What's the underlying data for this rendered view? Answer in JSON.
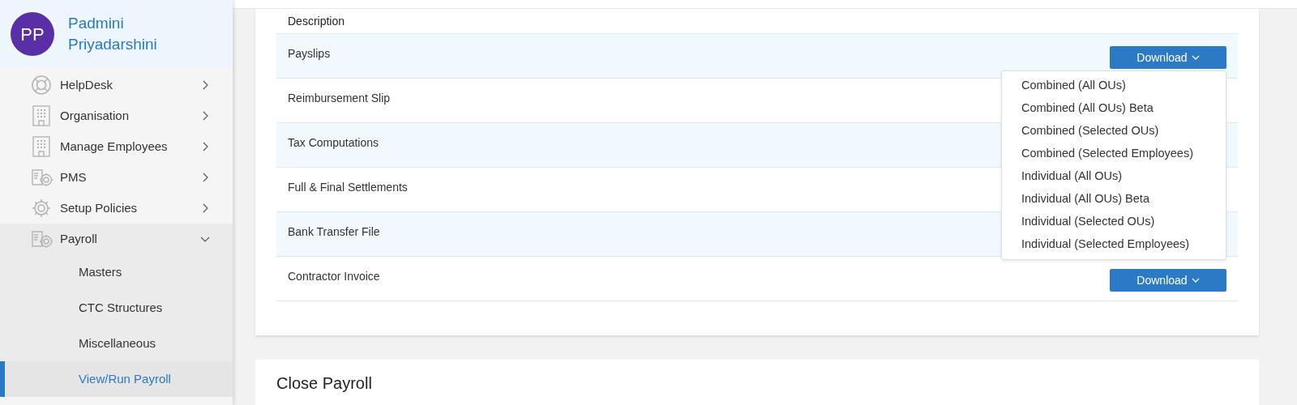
{
  "user": {
    "initials": "PP",
    "name": "Padmini Priyadarshini"
  },
  "sidebar": {
    "items": [
      {
        "label": "HelpDesk",
        "kind": "lifebuoy",
        "expanded": false
      },
      {
        "label": "Organisation",
        "kind": "building",
        "expanded": false
      },
      {
        "label": "Manage Employees",
        "kind": "building",
        "expanded": false
      },
      {
        "label": "PMS",
        "kind": "gear-doc",
        "expanded": false
      },
      {
        "label": "Setup Policies",
        "kind": "gear",
        "expanded": false
      },
      {
        "label": "Payroll",
        "kind": "gear-doc",
        "expanded": true,
        "children": [
          {
            "label": "Masters",
            "selected": false
          },
          {
            "label": "CTC Structures",
            "selected": false
          },
          {
            "label": "Miscellaneous",
            "selected": false
          },
          {
            "label": "View/Run Payroll",
            "selected": true
          }
        ]
      }
    ]
  },
  "table": {
    "columns": [
      "Description"
    ],
    "rows": [
      {
        "description": "Payslips",
        "action": "Download",
        "menu": [
          "Combined (All OUs)",
          "Combined (All OUs) Beta",
          "Combined (Selected OUs)",
          "Combined (Selected Employees)",
          "Individual (All OUs)",
          "Individual (All OUs) Beta",
          "Individual (Selected OUs)",
          "Individual (Selected Employees)"
        ]
      },
      {
        "description": "Reimbursement Slip"
      },
      {
        "description": "Tax Computations"
      },
      {
        "description": "Full & Final Settlements"
      },
      {
        "description": "Bank Transfer File"
      },
      {
        "description": "Contractor Invoice",
        "action": "Download"
      }
    ]
  },
  "close_section": {
    "title": "Close Payroll"
  }
}
